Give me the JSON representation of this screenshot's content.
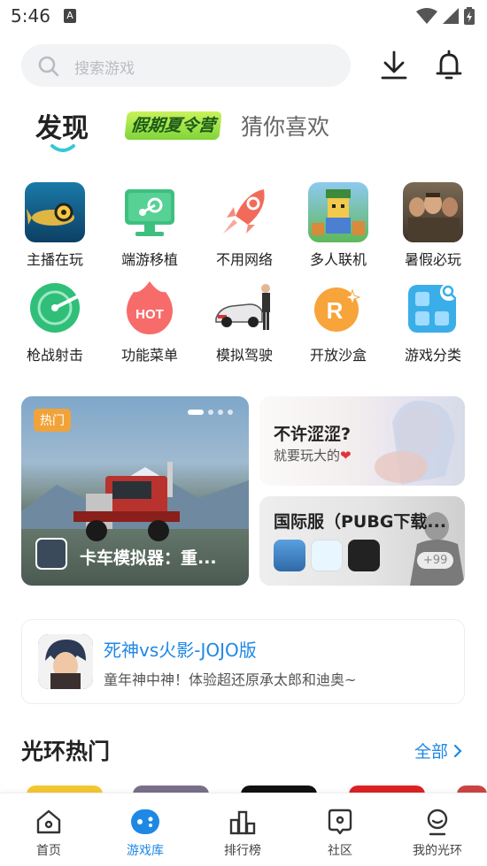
{
  "status_bar": {
    "time": "5:46",
    "sim_badge": "A"
  },
  "search": {
    "placeholder": "搜索游戏"
  },
  "tabs": {
    "main": "发现",
    "camp": "假期夏令营",
    "guess": "猜你喜欢"
  },
  "categories": [
    {
      "label": "主播在玩",
      "icon": "fish-game-icon"
    },
    {
      "label": "端游移植",
      "icon": "steam-monitor-icon"
    },
    {
      "label": "不用网络",
      "icon": "rocket-icon"
    },
    {
      "label": "多人联机",
      "icon": "roblox-game-icon"
    },
    {
      "label": "暑假必玩",
      "icon": "survivors-game-icon"
    },
    {
      "label": "枪战射击",
      "icon": "radar-icon"
    },
    {
      "label": "功能菜单",
      "icon": "hot-flame-icon"
    },
    {
      "label": "模拟驾驶",
      "icon": "car-driver-icon"
    },
    {
      "label": "开放沙盒",
      "icon": "sandbox-planet-icon"
    },
    {
      "label": "游戏分类",
      "icon": "category-grid-icon"
    }
  ],
  "banner": {
    "badge": "热门",
    "title": "卡车模拟器：重..."
  },
  "card1": {
    "title": "不许涩涩?",
    "subtitle": "就要玩大的",
    "heart": "❤"
  },
  "card2": {
    "title": "国际服（PUBG下载...",
    "more": "+99"
  },
  "recommend": {
    "title": "死神vs火影-JOJO版",
    "desc": "童年神中神！体验超还原承太郎和迪奥~"
  },
  "section": {
    "title": "光环热门",
    "all": "全部"
  },
  "nav": [
    {
      "label": "首页",
      "icon": "home-icon",
      "active": false
    },
    {
      "label": "游戏库",
      "icon": "gamepad-icon",
      "active": true
    },
    {
      "label": "排行榜",
      "icon": "ranking-icon",
      "active": false
    },
    {
      "label": "社区",
      "icon": "community-icon",
      "active": false
    },
    {
      "label": "我的光环",
      "icon": "profile-icon",
      "active": false
    }
  ],
  "colors": {
    "accent": "#1e88e5",
    "hot_badge": "#f1a33a",
    "camp_green": "#7fd43a"
  }
}
